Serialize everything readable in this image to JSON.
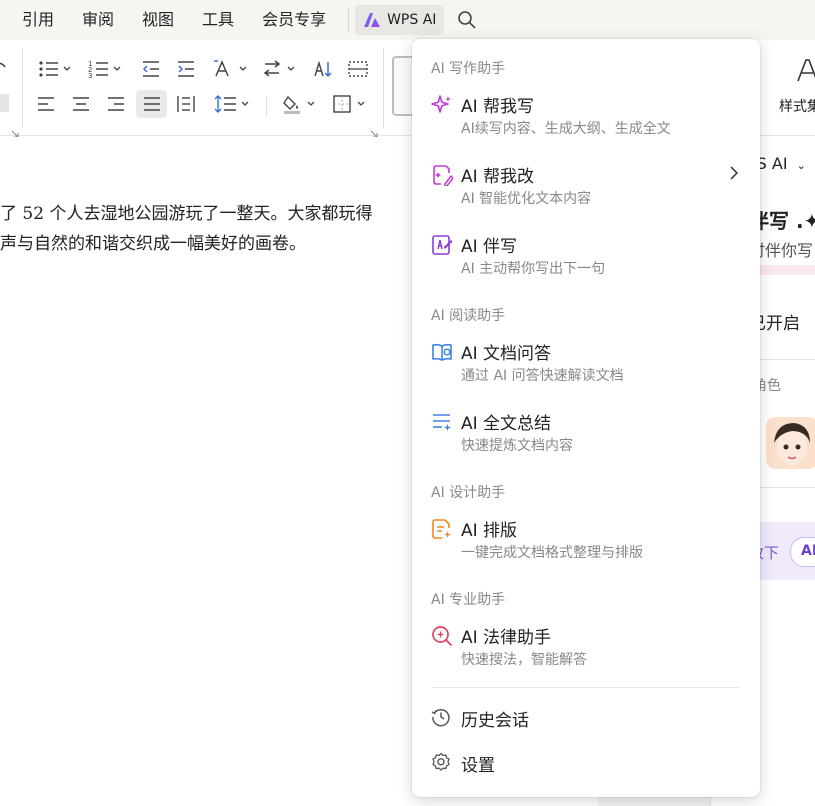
{
  "menubar": {
    "items": [
      "引用",
      "审阅",
      "视图",
      "工具",
      "会员专享"
    ],
    "wps_ai_label": "WPS AI",
    "icons": [
      "wps-ai-logo-icon",
      "search-icon"
    ]
  },
  "ribbon": {
    "style_label": "样式集"
  },
  "document": {
    "line1": "了 52 个人去湿地公园游玩了一整天。大家都玩得",
    "line2": "声与自然的和谐交织成一幅美好的画卷。"
  },
  "side_panel": {
    "title": "PS AI",
    "heading": "伴写 .✦",
    "subtitle": "时伴你写",
    "status": "已开启",
    "role_label": "角色",
    "below_text": "改下",
    "chip_label": "AI"
  },
  "dropdown": {
    "sections": [
      {
        "label": "AI 写作助手",
        "items": [
          {
            "title": "AI 帮我写",
            "desc": "AI续写内容、生成大纲、生成全文",
            "icon": "sparkle-icon",
            "color": "#c03bd6"
          },
          {
            "title": "AI 帮我改",
            "desc": "AI 智能优化文本内容",
            "icon": "edit-document-icon",
            "color": "#c03bd6",
            "has_submenu": true
          },
          {
            "title": "AI 伴写",
            "desc": "AI 主动帮你写出下一句",
            "icon": "companion-write-icon",
            "color": "#8e3bd6"
          }
        ]
      },
      {
        "label": "AI 阅读助手",
        "items": [
          {
            "title": "AI 文档问答",
            "desc": "通过 AI 问答快速解读文档",
            "icon": "book-qa-icon",
            "color": "#3b82e6"
          },
          {
            "title": "AI 全文总结",
            "desc": "快速提炼文档内容",
            "icon": "summary-icon",
            "color": "#3b82e6"
          }
        ]
      },
      {
        "label": "AI 设计助手",
        "items": [
          {
            "title": "AI 排版",
            "desc": "一键完成文档格式整理与排版",
            "icon": "layout-icon",
            "color": "#f08a1c"
          }
        ]
      },
      {
        "label": "AI 专业助手",
        "items": [
          {
            "title": "AI 法律助手",
            "desc": "快速搜法，智能解答",
            "icon": "legal-search-icon",
            "color": "#e0455e"
          }
        ]
      }
    ],
    "footer": [
      {
        "title": "历史会话",
        "icon": "history-icon"
      },
      {
        "title": "设置",
        "icon": "settings-gear-icon"
      }
    ]
  },
  "colors": {
    "menubar_bg": "#f6f5f1",
    "accent_purple": "#6b3fd6",
    "text": "#222222",
    "muted": "#888888"
  }
}
